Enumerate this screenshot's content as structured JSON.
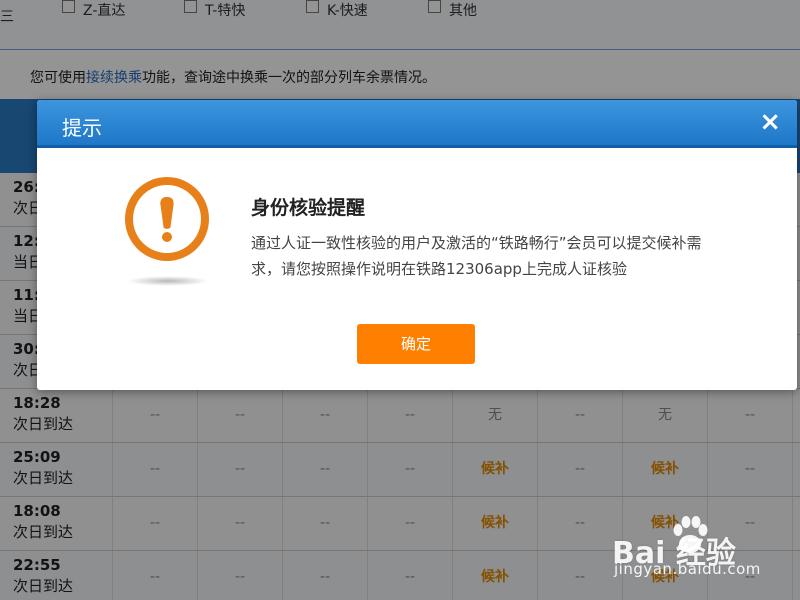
{
  "filters": {
    "left_glyph": "三",
    "items": [
      {
        "label": "Z-直达"
      },
      {
        "label": "T-特快"
      },
      {
        "label": "K-快速"
      },
      {
        "label": "其他"
      }
    ]
  },
  "notice": {
    "prefix": "您可使用",
    "link": "接续换乘",
    "suffix": "功能，查询途中换乘一次的部分列车余票情况。"
  },
  "rows": [
    {
      "time": "26:",
      "day": "次日",
      "cells": []
    },
    {
      "time": "12:",
      "day": "当日",
      "cells": []
    },
    {
      "time": "11:",
      "day": "当日",
      "cells": []
    },
    {
      "time": "30:",
      "day": "次日",
      "cells": []
    },
    {
      "time": "18:28",
      "day": "次日到达",
      "cells": [
        "--",
        "--",
        "--",
        "--",
        "无",
        "--",
        "无",
        "--"
      ]
    },
    {
      "time": "25:09",
      "day": "次日到达",
      "cells": [
        "--",
        "--",
        "--",
        "--",
        "候补",
        "--",
        "候补",
        "--"
      ]
    },
    {
      "time": "18:08",
      "day": "次日到达",
      "cells": [
        "--",
        "--",
        "--",
        "--",
        "候补",
        "--",
        "候补",
        "--"
      ]
    },
    {
      "time": "22:55",
      "day": "次日到达",
      "cells": [
        "--",
        "--",
        "--",
        "--",
        "候补",
        "--",
        "候补",
        "--"
      ]
    }
  ],
  "dialog": {
    "title": "提示",
    "close_glyph": "×",
    "icon": "warning-exclamation-icon",
    "heading": "身份核验提醒",
    "body": "通过人证一致性核验的用户及激活的“铁路畅行”会员可以提交候补需求，请您按照操作说明在铁路12306app上完成人证核验",
    "ok_label": "确定"
  },
  "watermark": {
    "main": "Bai 经验",
    "sub": "jingyan.baidu.com"
  },
  "colors": {
    "header_blue": "#1e78c8",
    "button_orange": "#ff8000",
    "icon_orange": "#e8801a",
    "waitlist_orange": "#e68a00"
  }
}
